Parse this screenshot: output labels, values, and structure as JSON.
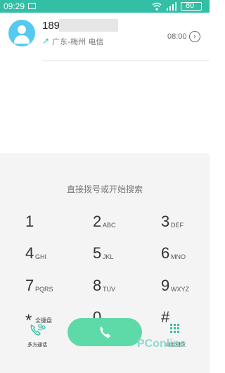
{
  "status_bar": {
    "time": "09:29",
    "battery": "80"
  },
  "call_log": {
    "entries": [
      {
        "number": "189",
        "location": "广东-梅州 电信",
        "time": "08:00"
      }
    ]
  },
  "dialer": {
    "hint": "直接拨号或开始搜索",
    "keys": [
      {
        "digit": "1",
        "letters": ""
      },
      {
        "digit": "2",
        "letters": "ABC"
      },
      {
        "digit": "3",
        "letters": "DEF"
      },
      {
        "digit": "4",
        "letters": "GHI"
      },
      {
        "digit": "5",
        "letters": "JKL"
      },
      {
        "digit": "6",
        "letters": "MNO"
      },
      {
        "digit": "7",
        "letters": "PQRS"
      },
      {
        "digit": "8",
        "letters": "TUV"
      },
      {
        "digit": "9",
        "letters": "WXYZ"
      },
      {
        "digit": "*",
        "letters": "全键盘"
      },
      {
        "digit": "0",
        "letters": "+"
      },
      {
        "digit": "#",
        "letters": ""
      }
    ]
  },
  "bottom_bar": {
    "multi_call_label": "多方通话",
    "collapse_label": "收起键盘"
  },
  "watermark": "PConline",
  "colors": {
    "status_bar": "#33bfa6",
    "call_button": "#5ed9a8",
    "avatar": "#55c9f0",
    "accent": "#33bfa6"
  },
  "icons": {
    "notification": "image-notification-icon",
    "wifi": "wifi-icon",
    "signal": "signal-icon",
    "battery": "battery-icon",
    "avatar": "person-icon",
    "outgoing": "outgoing-call-arrow-icon",
    "detail": "chevron-right-circle-icon",
    "call": "phone-icon",
    "multi_call": "multi-party-call-icon",
    "collapse": "dialpad-icon"
  }
}
